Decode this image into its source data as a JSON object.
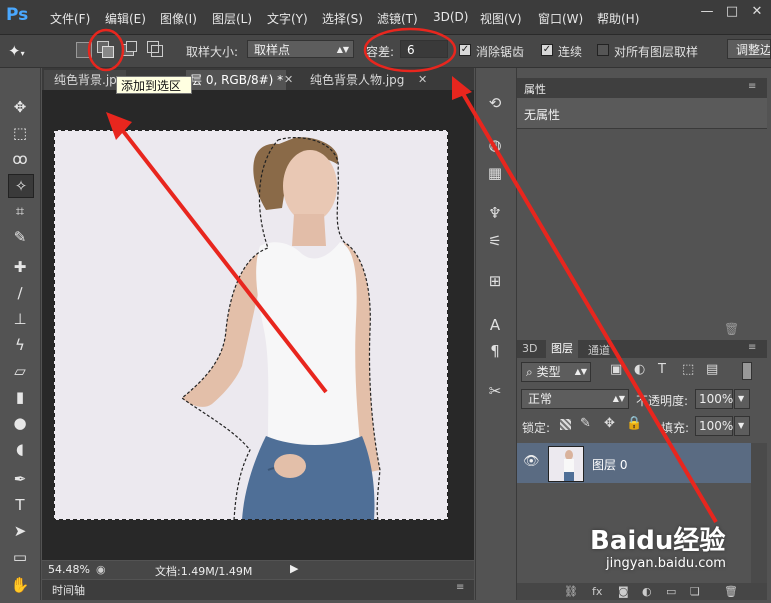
{
  "app": {
    "logo": "Ps"
  },
  "menu": [
    "文件(F)",
    "编辑(E)",
    "图像(I)",
    "图层(L)",
    "文字(Y)",
    "选择(S)",
    "滤镜(T)",
    "3D(D)",
    "视图(V)",
    "窗口(W)",
    "帮助(H)"
  ],
  "window_controls": {
    "minimize": "—",
    "maximize": "□",
    "close": "✕"
  },
  "options": {
    "sample_size_label": "取样大小:",
    "sample_size_value": "取样点",
    "tolerance_label": "容差:",
    "tolerance_value": "6",
    "antialias_label": "消除锯齿",
    "antialias_checked": true,
    "contiguous_label": "连续",
    "contiguous_checked": true,
    "sample_all_label": "对所有图层取样",
    "sample_all_checked": false,
    "refine_edge_label": "调整边",
    "tooltip": "添加到选区"
  },
  "tabs": [
    {
      "label": "纯色背景.jp"
    },
    {
      "label": "层 0, RGB/8#) *"
    },
    {
      "label": "纯色背景人物.jpg"
    }
  ],
  "status": {
    "zoom": "54.48%",
    "doc": "文档:1.49M/1.49M"
  },
  "timeline": {
    "label": "时间轴"
  },
  "properties": {
    "title": "属性",
    "content": "无属性"
  },
  "layers_panel": {
    "tabs": [
      "3D",
      "图层",
      "通道"
    ],
    "filter_kind": "类型",
    "blend_mode": "正常",
    "opacity_label": "不透明度:",
    "opacity_value": "100%",
    "lock_label": "锁定:",
    "fill_label": "填充:",
    "fill_value": "100%",
    "layer_name": "图层 0"
  },
  "watermark": {
    "brand": "Baidu经验",
    "url": "jingyan.baidu.com"
  },
  "icons": [
    "move-icon",
    "marquee-icon",
    "lasso-icon",
    "magic-wand-icon",
    "crop-icon",
    "eyedropper-icon",
    "healing-brush-icon",
    "brush-icon",
    "stamp-icon",
    "history-brush-icon",
    "eraser-icon",
    "gradient-icon",
    "blur-icon",
    "dodge-icon",
    "pen-icon",
    "type-icon",
    "path-selection-icon",
    "shape-icon",
    "hand-icon"
  ],
  "colors": {
    "annotation_red": "#e8261e",
    "accent_blue": "#4aa8ff",
    "selected_layer": "#5a6b82"
  }
}
